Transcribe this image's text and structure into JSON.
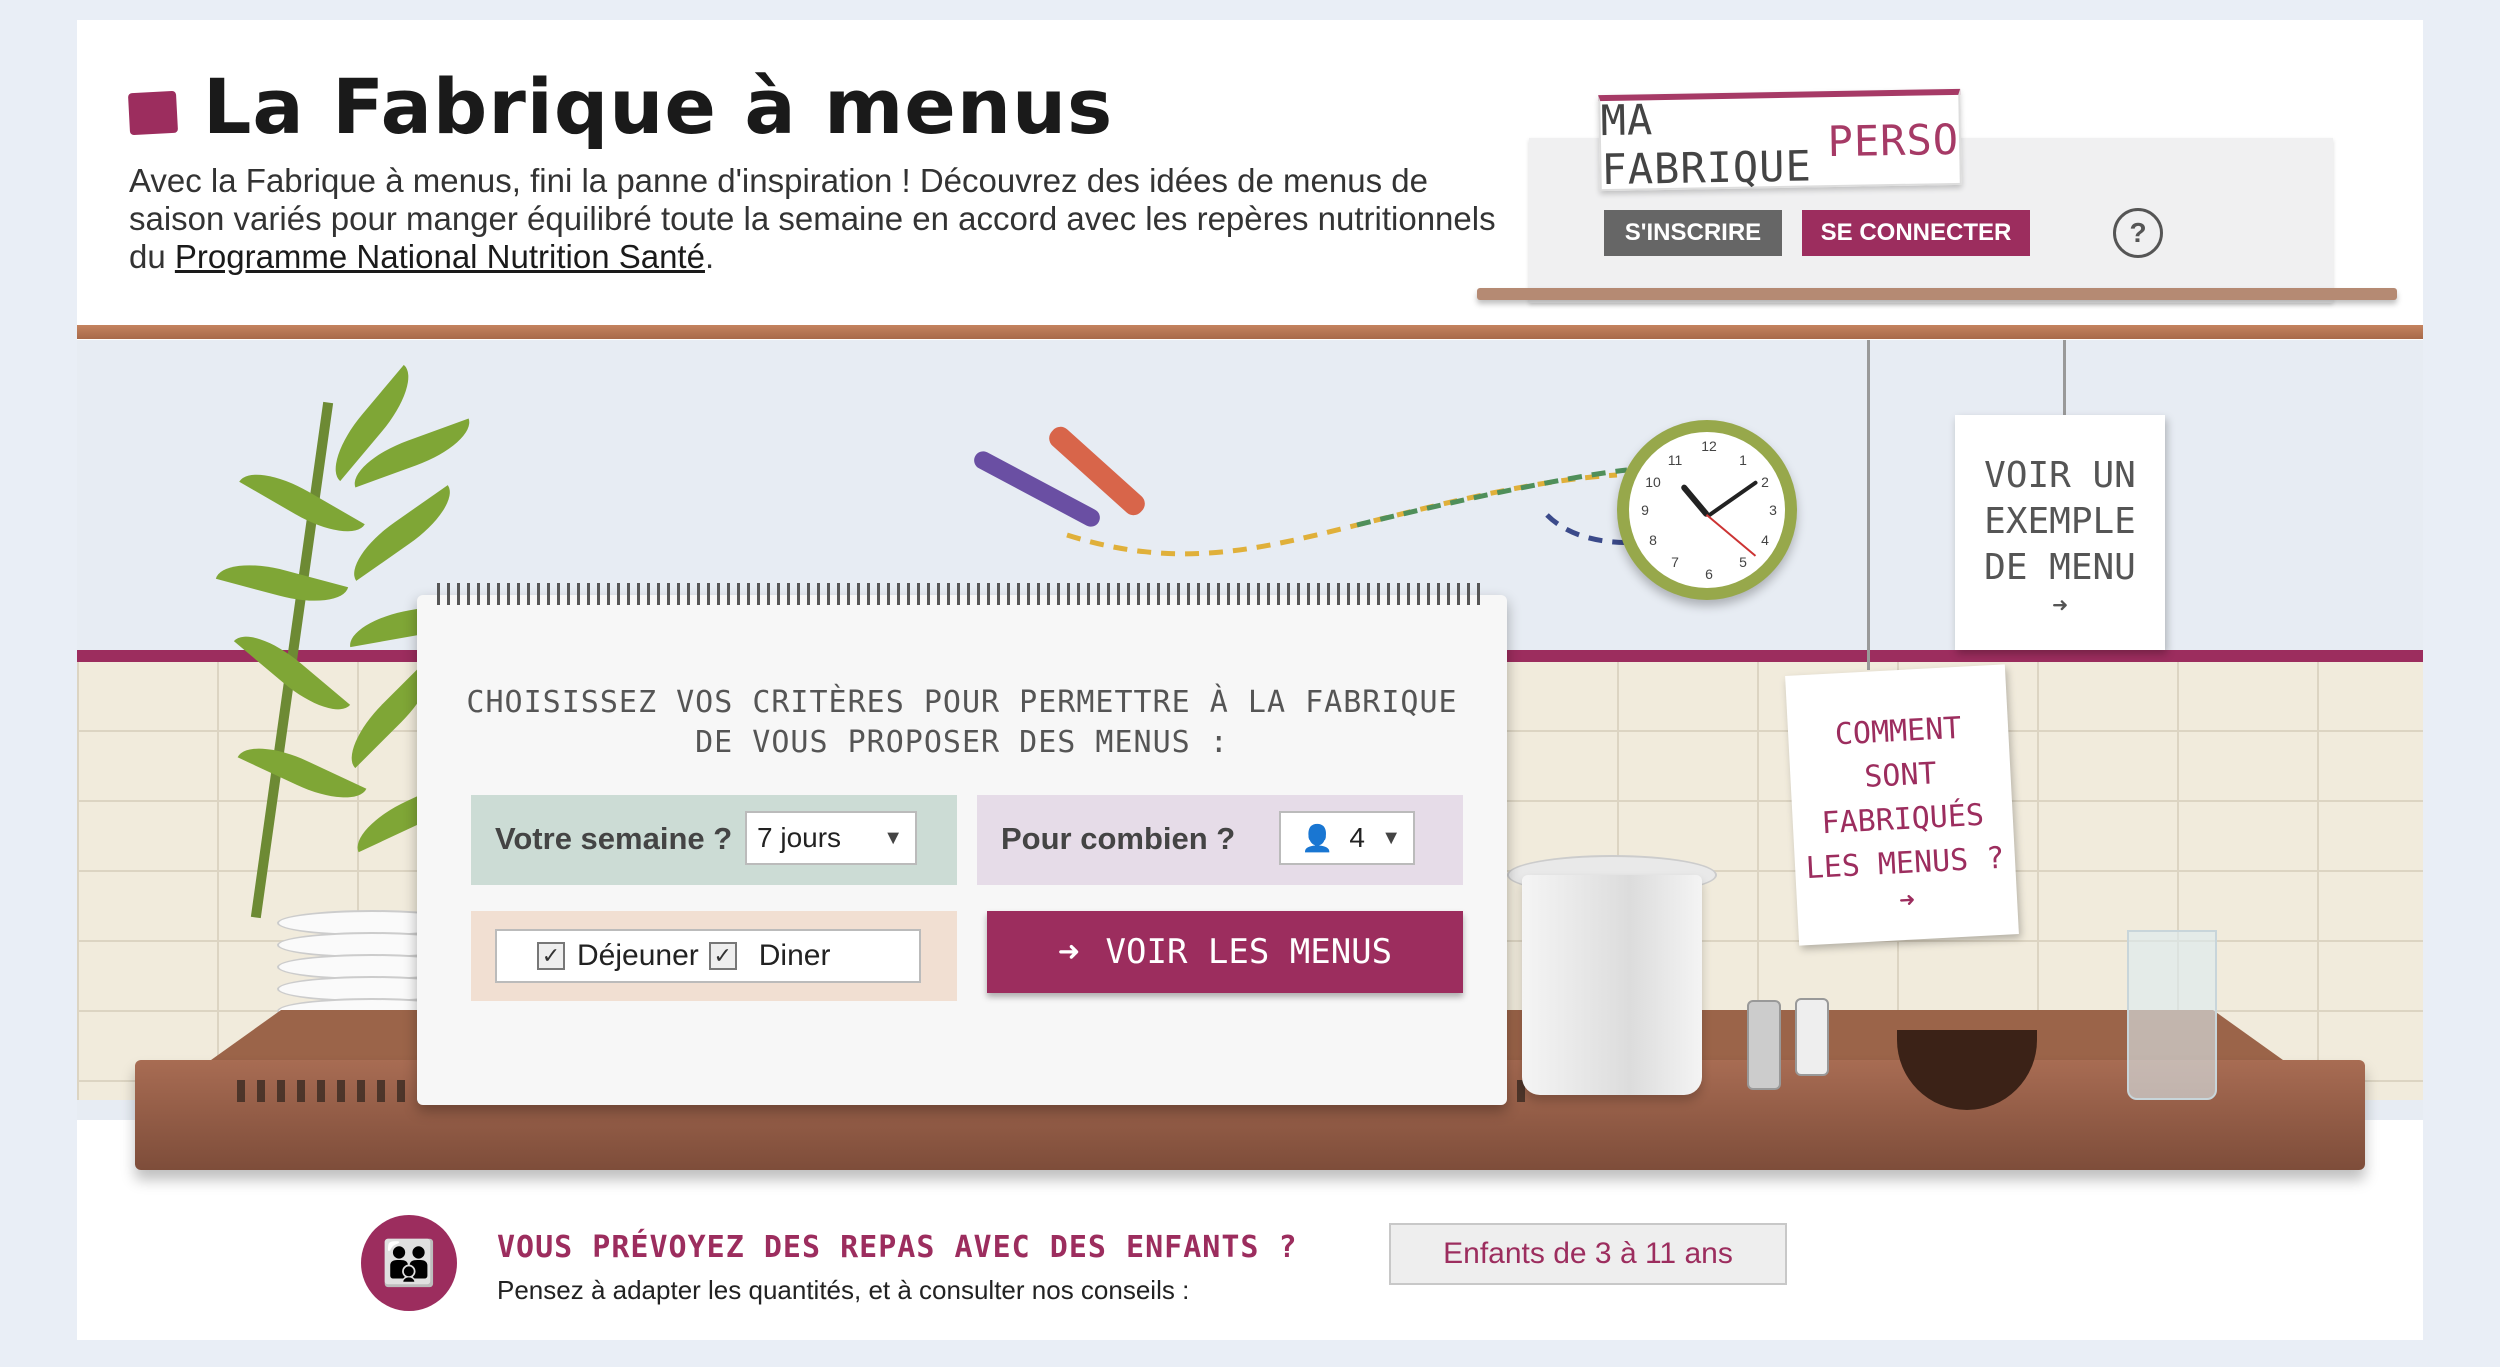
{
  "header": {
    "title": "La Fabrique à menus",
    "intro_text": "Avec la Fabrique à menus, fini la panne d'inspiration ! Découvrez des idées de menus de saison variés pour manger équilibré toute la semaine en accord avec les repères nutritionnels du ",
    "intro_link": "Programme National Nutrition Santé",
    "intro_end": "."
  },
  "perso": {
    "tag_main": "MA FABRIQUE",
    "tag_accent": "PERSO",
    "register_label": "S'INSCRIRE",
    "login_label": "SE CONNECTER",
    "help_label": "?"
  },
  "notes": {
    "example": [
      "VOIR UN",
      "EXEMPLE",
      "DE MENU"
    ],
    "how": [
      "COMMENT",
      "SONT",
      "FABRIQUÉS",
      "LES MENUS ?"
    ]
  },
  "form": {
    "heading_line1": "CHOISISSEZ VOS CRITÈRES POUR PERMETTRE À LA FABRIQUE",
    "heading_line2": "DE VOUS PROPOSER DES MENUS :",
    "semaine_label": "Votre semaine ?",
    "semaine_value": "7 jours",
    "combien_label": "Pour combien ?",
    "combien_value": "4",
    "dejeuner_label": "Déjeuner",
    "diner_label": "Diner",
    "submit_label": "VOIR LES MENUS"
  },
  "kids": {
    "title": "VOUS PRÉVOYEZ DES REPAS AVEC DES ENFANTS ?",
    "subtitle": "Pensez à adapter les quantités, et à consulter nos conseils :",
    "button": "Enfants de 3 à 11 ans"
  },
  "colors": {
    "brand": "#9c2d5e",
    "green_panel": "#ccdcd5",
    "lilac_panel": "#e6dce8",
    "peach_panel": "#f1dfd2"
  },
  "icons": [
    "brand-square-icon",
    "help-icon",
    "clock-icon",
    "fork-icon",
    "knife-icon",
    "user-icon",
    "dropdown-arrow-icon",
    "checkbox-icon",
    "arrow-right-icon",
    "family-icon"
  ]
}
